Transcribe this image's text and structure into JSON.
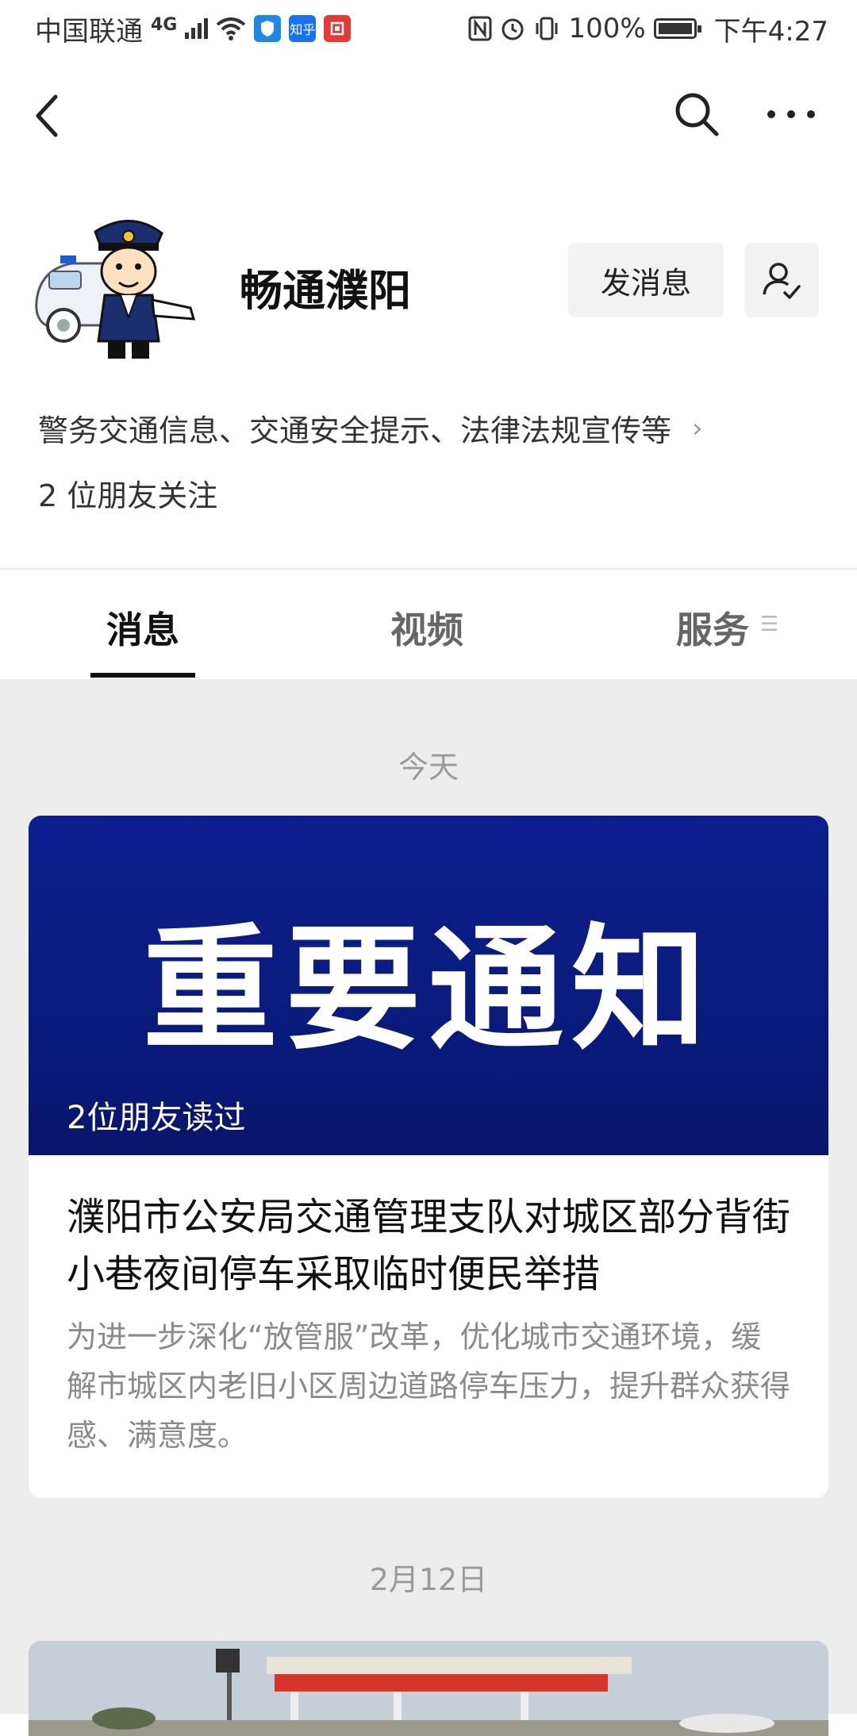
{
  "status_bar": {
    "carrier": "中国联通",
    "network": "4G",
    "battery": "100%",
    "time": "下午4:27",
    "app_icons": [
      "知乎"
    ]
  },
  "nav": {
    "back_icon": "chevron-left-icon",
    "search_icon": "search-icon",
    "more_icon": "more-horizontal-icon"
  },
  "profile": {
    "name": "畅通濮阳",
    "message_button": "发消息",
    "description": "警务交通信息、交通安全提示、法律法规宣传等",
    "friends_following": "2 位朋友关注"
  },
  "tabs": [
    {
      "label": "消息",
      "active": true
    },
    {
      "label": "视频",
      "active": false
    },
    {
      "label": "服务",
      "active": false
    }
  ],
  "feed": {
    "groups": [
      {
        "date": "今天",
        "article": {
          "banner_text": "重要通知",
          "read_by": "2位朋友读过",
          "title": "濮阳市公安局交通管理支队对城区部分背街小巷夜间停车采取临时便民举措",
          "summary": "为进一步深化“放管服”改革，优化城市交通环境，缓解市城区内老旧小区周边道路停车压力，提升群众获得感、满意度。"
        }
      },
      {
        "date": "2月12日"
      }
    ]
  },
  "colors": {
    "banner_blue": "#0d1f8e",
    "feed_background": "#ededed",
    "muted_text": "#8a8a8a"
  }
}
